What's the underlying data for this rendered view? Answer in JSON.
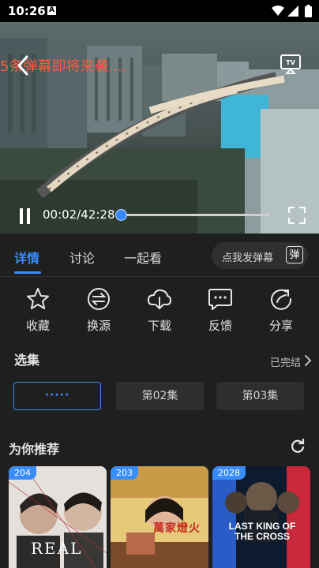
{
  "status_bar": {
    "time": "10:26",
    "notification_letter": "A"
  },
  "player": {
    "danmaku_text": "5条弹幕即将来袭....",
    "current_time": "00:02",
    "duration": "42:28",
    "time_display": "00:02/42:28",
    "progress_fraction": 0.0008
  },
  "tabs": [
    {
      "label": "详情"
    },
    {
      "label": "讨论"
    },
    {
      "label": "一起看"
    }
  ],
  "danmaku_button": {
    "label": "点我发弹幕",
    "icon_text": "弹"
  },
  "actions": [
    {
      "label": "收藏",
      "icon": "star-icon"
    },
    {
      "label": "换源",
      "icon": "switch-source-icon"
    },
    {
      "label": "下载",
      "icon": "download-icon"
    },
    {
      "label": "反馈",
      "icon": "feedback-icon"
    },
    {
      "label": "分享",
      "icon": "share-icon"
    }
  ],
  "episodes": {
    "title": "选集",
    "status": "已完结",
    "items": [
      {
        "label": "·····"
      },
      {
        "label": "第02集"
      },
      {
        "label": "第03集"
      }
    ]
  },
  "recommend": {
    "title": "为你推荐",
    "posters": [
      {
        "badge": "204",
        "text": "REAL"
      },
      {
        "badge": "203",
        "text": "萬家燈火"
      },
      {
        "badge": "2028",
        "text": "LAST KING OF THE CROSS"
      }
    ]
  },
  "colors": {
    "accent": "#3a8df8",
    "danmaku": "#ff5a3c",
    "background": "#1f1f1f"
  }
}
